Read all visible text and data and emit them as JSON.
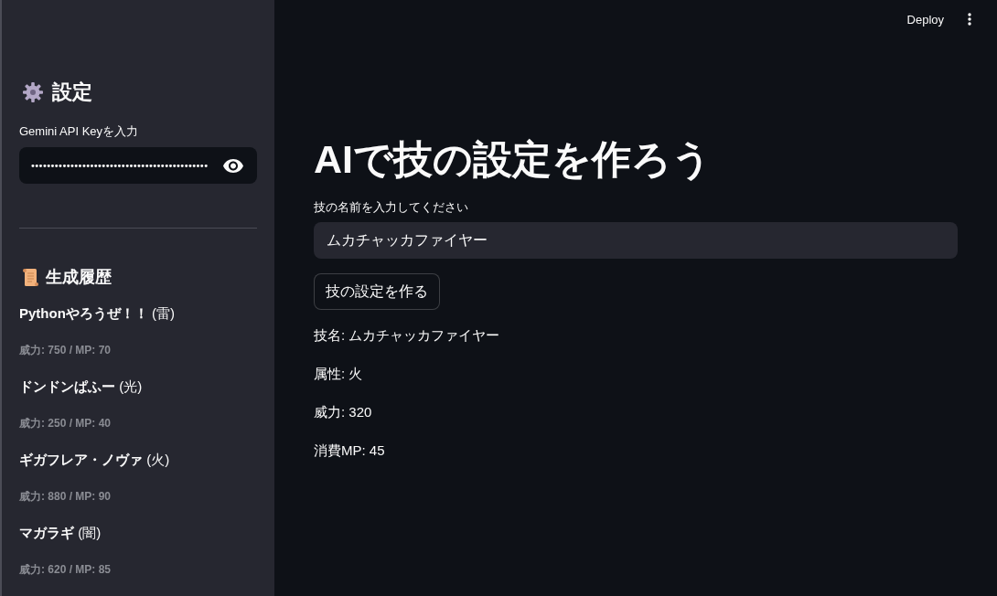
{
  "header": {
    "deploy_label": "Deploy"
  },
  "sidebar": {
    "title": "設定",
    "api_key": {
      "label": "Gemini API Keyを入力",
      "value": "•••••••••••••••••••••••••••••••••••••••••••••"
    },
    "history": {
      "title": "生成履歴",
      "items": [
        {
          "title": "**Pythonやろうぜ！！** (雷)",
          "stats": "威力: 750 / MP: 70"
        },
        {
          "title": "**ドンドンぱふー** (光)",
          "stats": "威力: 250 / MP: 40"
        },
        {
          "title": "**ギガフレア・ノヴァ** (火)",
          "stats": "威力: 880 / MP: 90"
        },
        {
          "title": "**マガラギ** (闇)",
          "stats": "威力: 620 / MP: 85"
        }
      ]
    }
  },
  "main": {
    "title": "AIで技の設定を作ろう",
    "name_input": {
      "label": "技の名前を入力してください",
      "value": "ムカチャッカファイヤー"
    },
    "submit_button": "技の設定を作る",
    "results": [
      "技名: ムカチャッカファイヤー",
      "属性: 火",
      "威力: 320",
      "消費MP: 45"
    ]
  }
}
